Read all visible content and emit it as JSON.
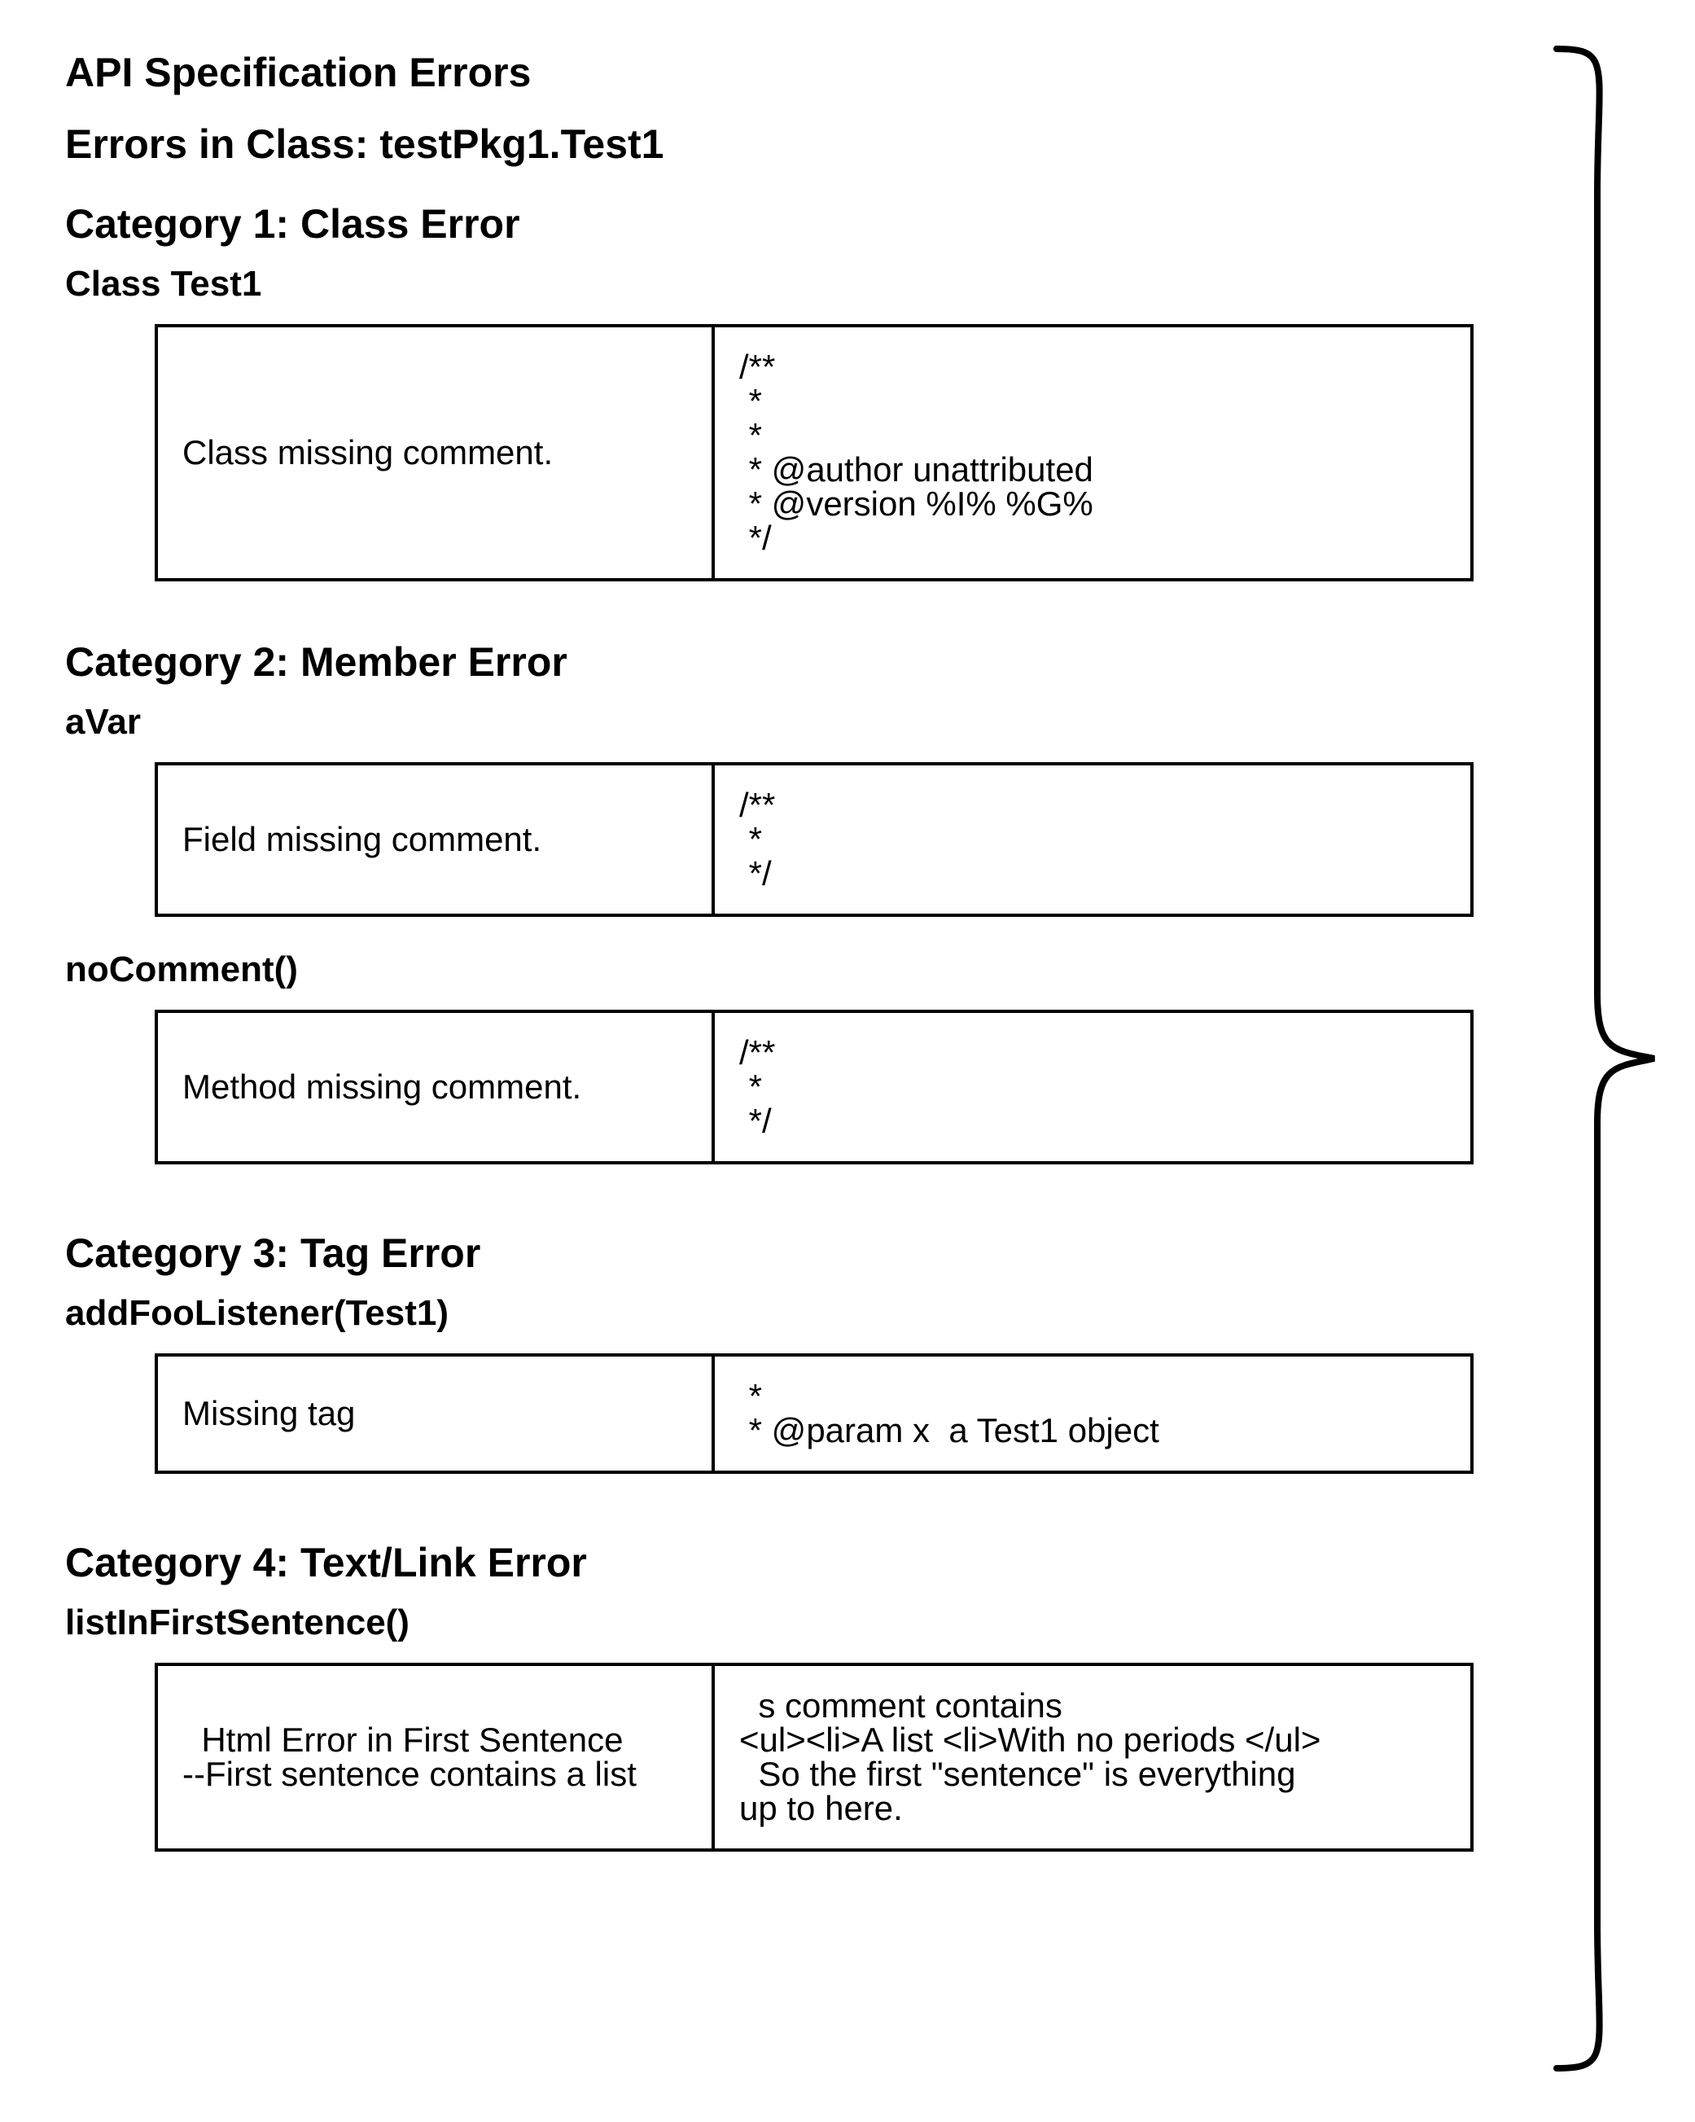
{
  "title_main": "API Specification Errors",
  "title_errors_in": "Errors in Class: testPkg1.Test1",
  "cat1_heading": "Category 1: Class Error",
  "cat1_item": "Class Test1",
  "cat1_desc": "Class missing comment.",
  "cat1_code": "/**\n *\n *\n * @author unattributed\n * @version %I% %G%\n */",
  "cat2_heading": "Category 2: Member Error",
  "cat2_item_a": "aVar",
  "cat2_desc_a": "Field missing comment.",
  "cat2_code_a": "/**\n *\n */",
  "cat2_item_b": "noComment()",
  "cat2_desc_b": "Method missing comment.",
  "cat2_code_b": "/**\n *\n */",
  "cat3_heading": "Category 3: Tag Error",
  "cat3_item": "addFooListener(Test1)",
  "cat3_desc": "Missing tag",
  "cat3_code": " *\n * @param x  a Test1 object",
  "cat4_heading": "Category 4: Text/Link Error",
  "cat4_item": "listInFirstSentence()",
  "cat4_desc": "  Html Error in First Sentence\n--First sentence contains a list",
  "cat4_code": "  s comment contains\n<ul><li>A list <li>With no periods </ul>\n  So the first \"sentence\" is everything\nup to here."
}
